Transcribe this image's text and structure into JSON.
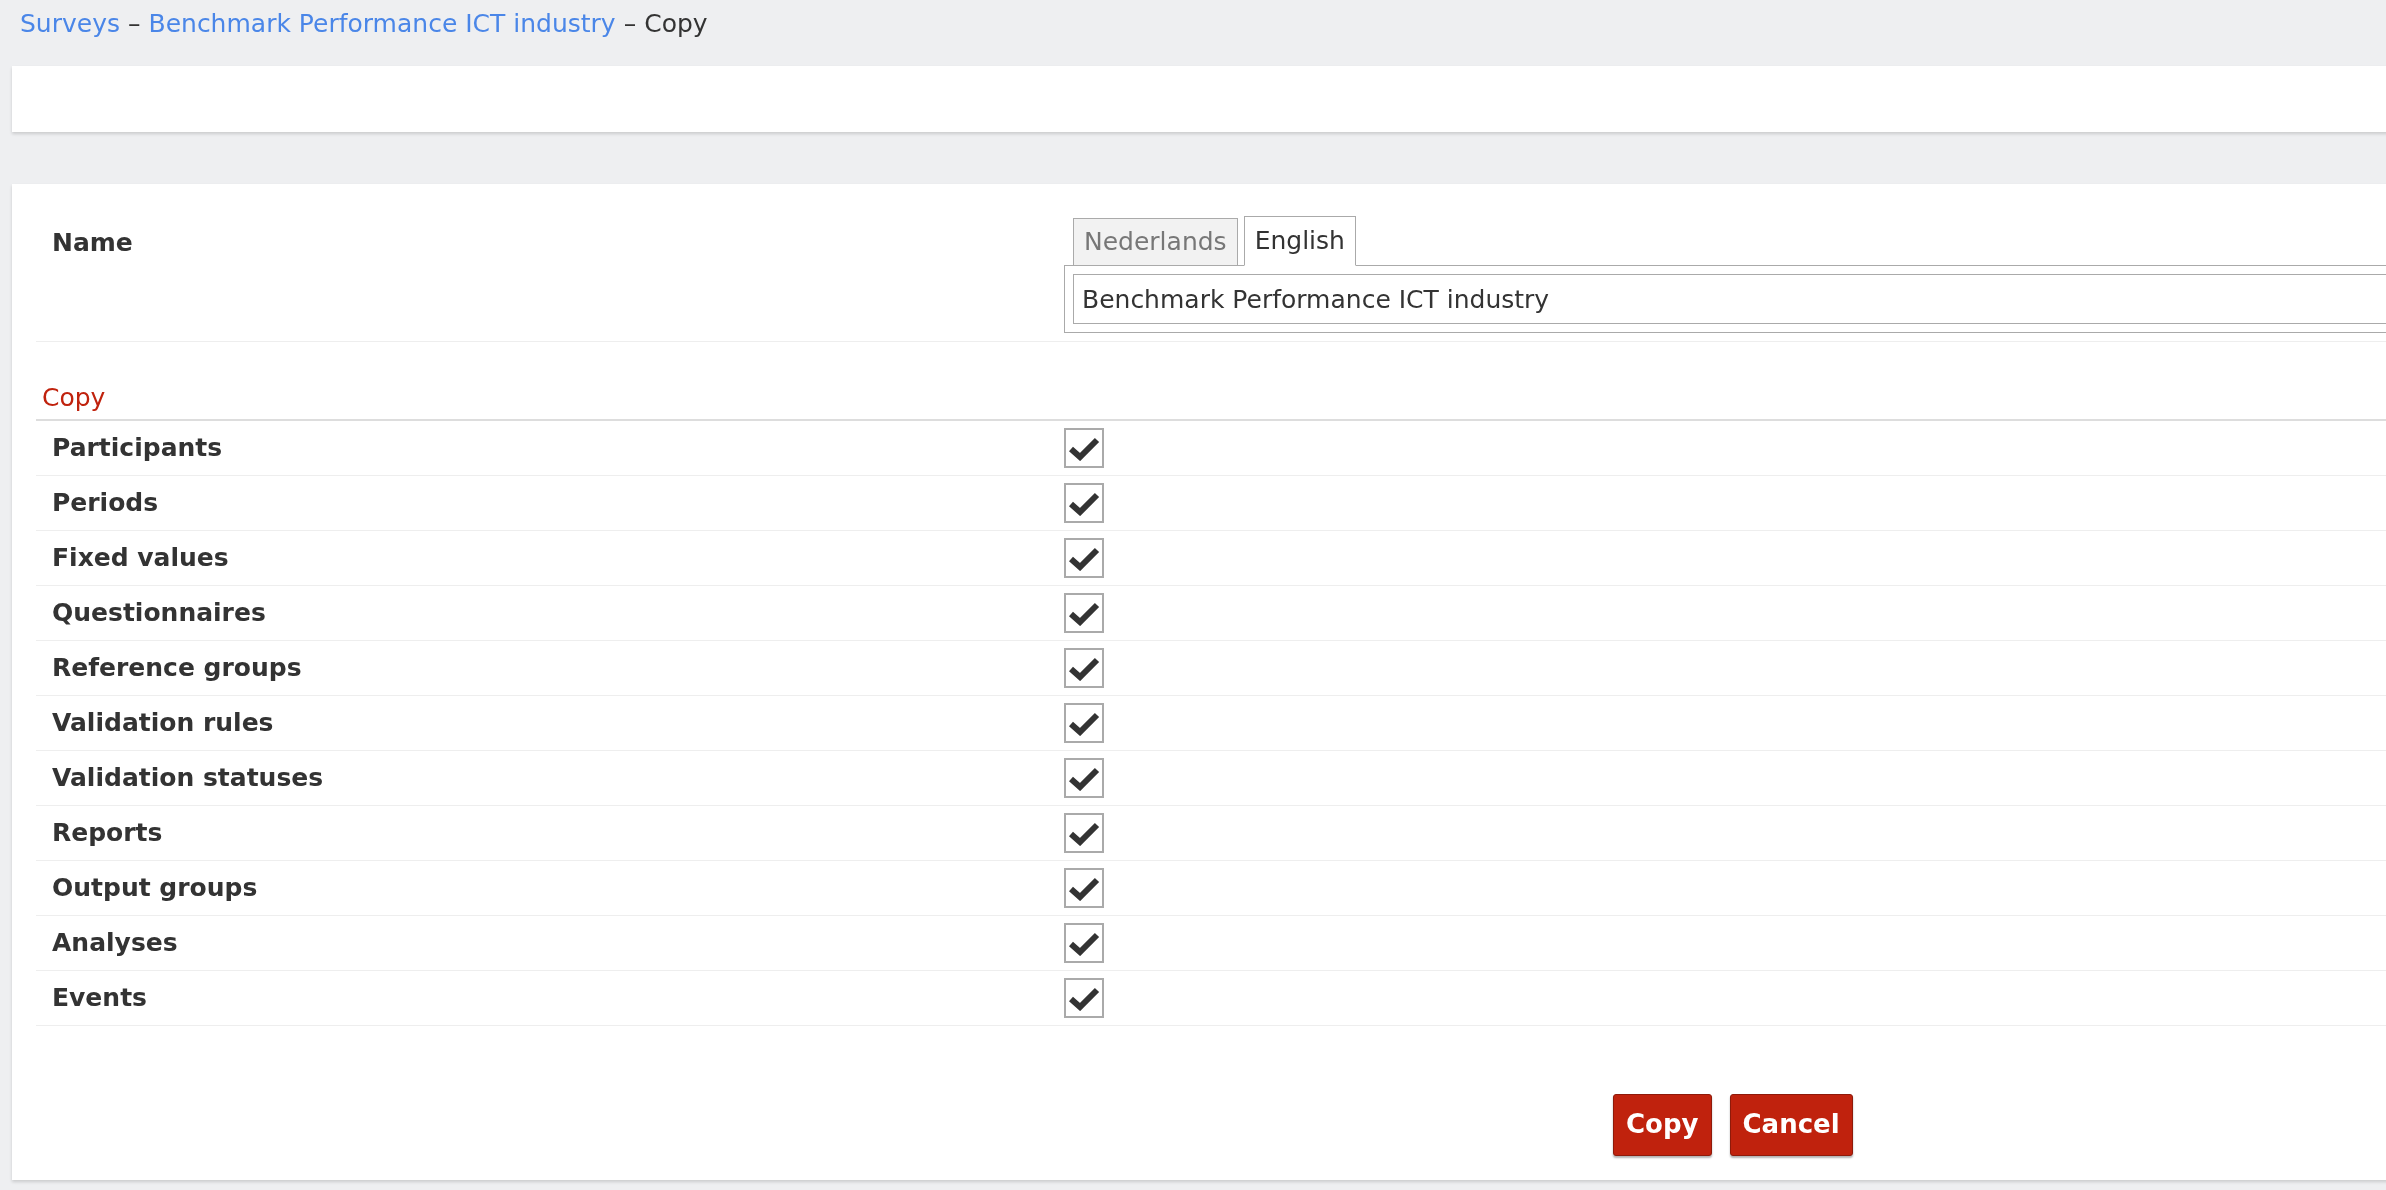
{
  "breadcrumb": [
    {
      "kind": "link",
      "label": "Surveys"
    },
    {
      "kind": "separator",
      "label": "–"
    },
    {
      "kind": "link",
      "label": "Benchmark Performance ICT industry"
    },
    {
      "kind": "separator",
      "label": "–"
    },
    {
      "kind": "current",
      "label": "Copy"
    }
  ],
  "name_field": {
    "label": "Name",
    "tabs": [
      {
        "label": "Nederlands",
        "selected": false
      },
      {
        "label": "English",
        "selected": true
      }
    ],
    "value": "Benchmark Performance ICT industry"
  },
  "copy_section": {
    "title": "Copy",
    "options": [
      {
        "label": "Participants",
        "checked": true
      },
      {
        "label": "Periods",
        "checked": true
      },
      {
        "label": "Fixed values",
        "checked": true
      },
      {
        "label": "Questionnaires",
        "checked": true
      },
      {
        "label": "Reference groups",
        "checked": true
      },
      {
        "label": "Validation rules",
        "checked": true
      },
      {
        "label": "Validation statuses",
        "checked": true
      },
      {
        "label": "Reports",
        "checked": true
      },
      {
        "label": "Output groups",
        "checked": true
      },
      {
        "label": "Analyses",
        "checked": true
      },
      {
        "label": "Events",
        "checked": true
      }
    ]
  },
  "buttons": [
    "Copy",
    "Cancel"
  ]
}
